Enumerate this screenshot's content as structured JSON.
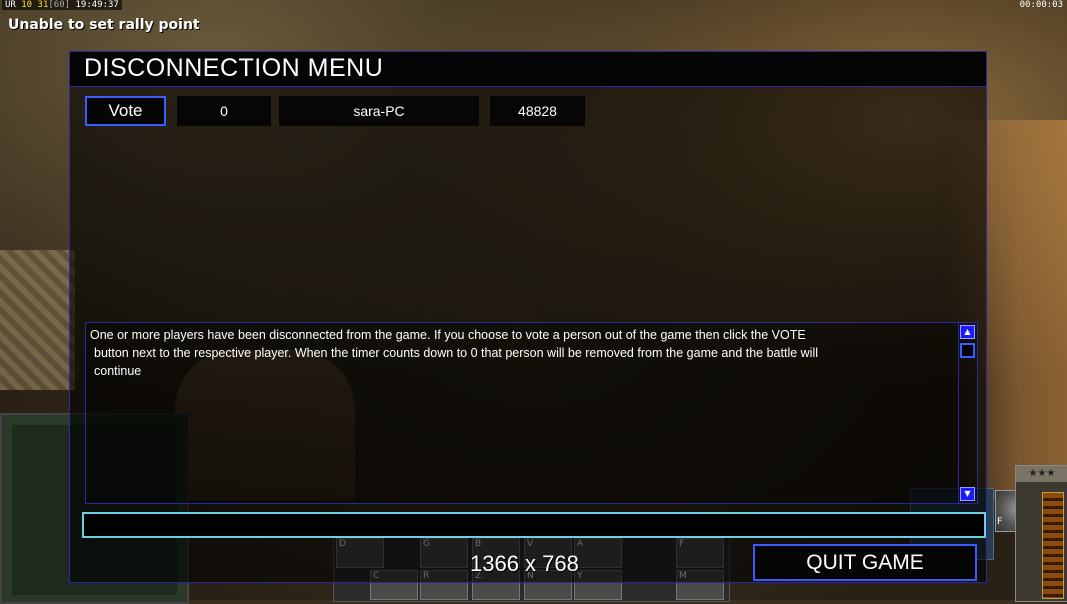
{
  "hud": {
    "top_left_prefix": "UR ",
    "top_left_a": "10",
    "top_left_b": "31",
    "top_left_c": "[60]",
    "top_left_time": " 19:49:37",
    "top_right_timer": "00:00:03",
    "notice": "Unable to set rally point"
  },
  "dialog": {
    "title": "DISCONNECTION MENU",
    "players": [
      {
        "vote_label": "Vote",
        "votes": "0",
        "name": "sara-PC",
        "ping": "48828"
      }
    ],
    "message": {
      "line1": "One or more players have been disconnected from the game. If you choose to vote a person out of the game then click the VOTE",
      "line2": "button next to the respective player. When the timer counts down to 0 that person will be removed from the game and the battle will",
      "line3": "continue"
    },
    "chat_input_value": "",
    "quit_label": "QUIT GAME"
  },
  "overlay": {
    "resolution": "1366 x 768"
  },
  "command_bar": {
    "slots": [
      "D",
      "G",
      "B",
      "V",
      "A",
      "C",
      "R",
      "Z",
      "N",
      "Y",
      "M",
      "F"
    ]
  },
  "rank": {
    "stars": "★★★"
  },
  "colors": {
    "accent_border": "#3a5cff",
    "input_border": "#6ecfe0",
    "dialog_border": "#2a2a9c"
  }
}
